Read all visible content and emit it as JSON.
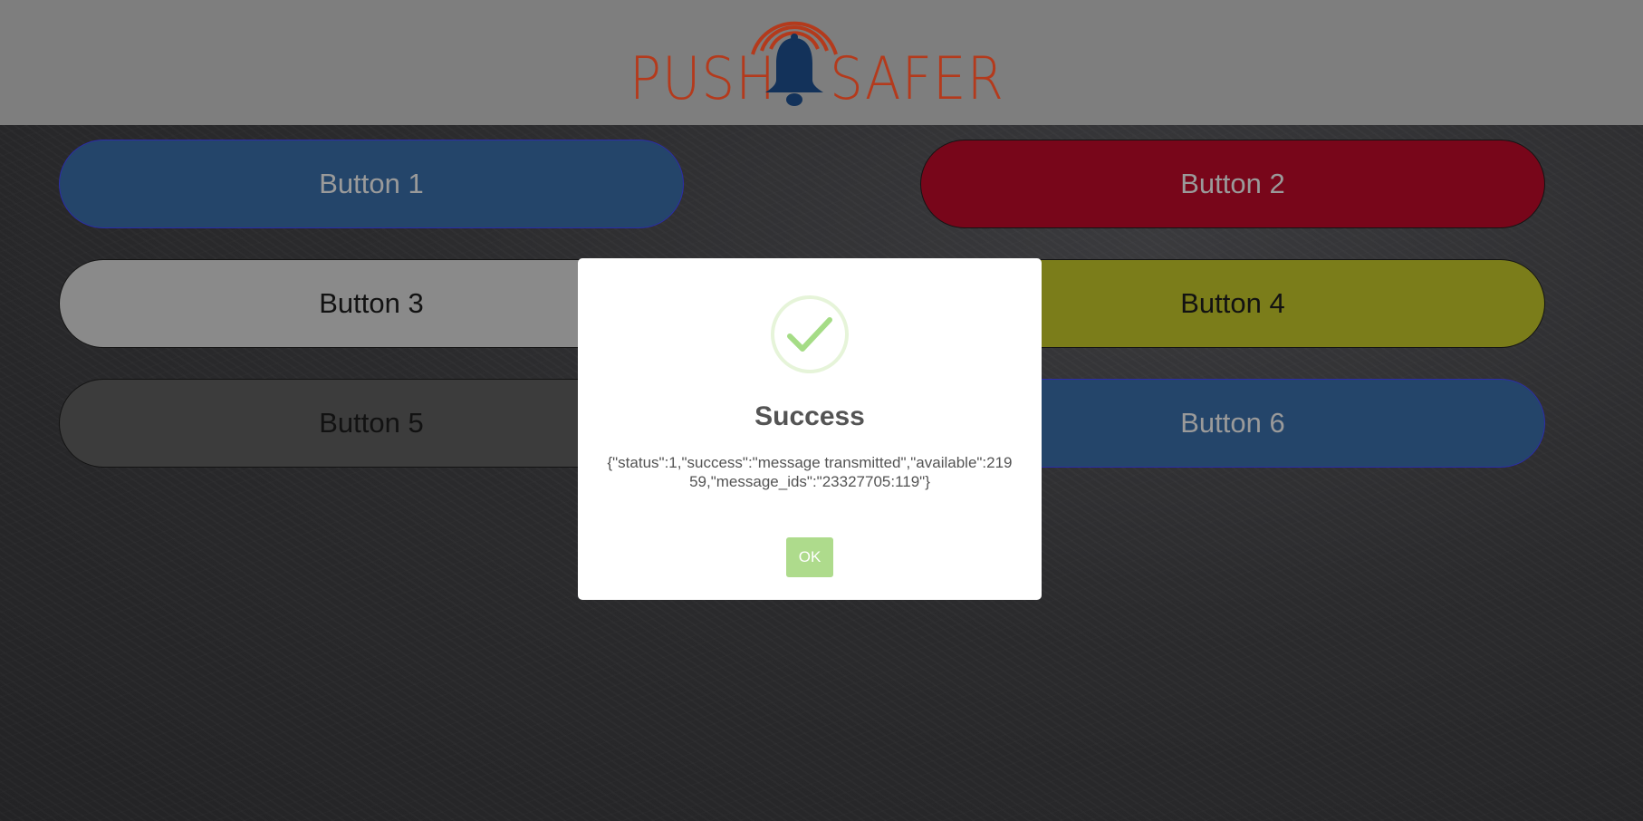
{
  "header": {
    "logo": {
      "text_left": "PUSH",
      "text_right": "SAFER",
      "icon": "bell-icon",
      "text_color": "#b43a1c",
      "bell_color": "#13325a"
    }
  },
  "buttons": [
    {
      "label": "Button 1",
      "color": "#24456a"
    },
    {
      "label": "Button 2",
      "color": "#78061a"
    },
    {
      "label": "Button 3",
      "color": "#8a8a8a"
    },
    {
      "label": "Button 4",
      "color": "#7b7d1a"
    },
    {
      "label": "Button 5",
      "color": "#3c3c3c"
    },
    {
      "label": "Button 6",
      "color": "#24456a"
    }
  ],
  "dialog": {
    "icon": "checkmark-icon",
    "title": "Success",
    "message": "{\"status\":1,\"success\":\"message transmitted\",\"available\":21959,\"message_ids\":\"23327705:119\"}",
    "ok_label": "OK",
    "accent_color": "#a5dc86"
  }
}
